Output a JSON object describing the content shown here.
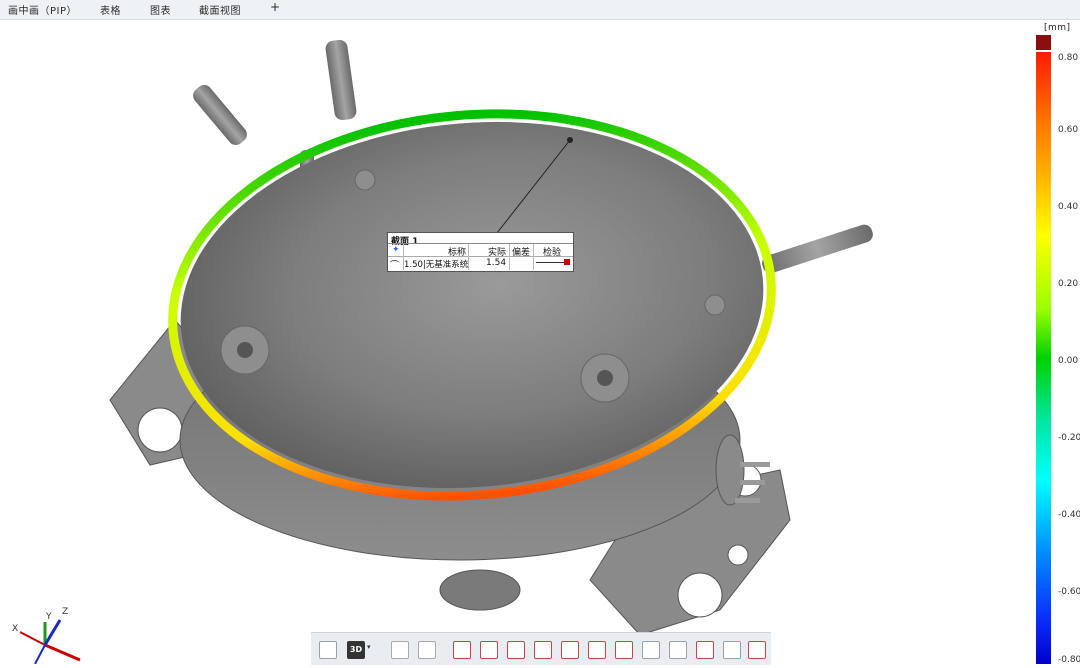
{
  "tabs": [
    {
      "label": "画中画（PIP）"
    },
    {
      "label": "表格"
    },
    {
      "label": "图表"
    },
    {
      "label": "截面视图"
    }
  ],
  "add_tab_label": "+",
  "color_scale": {
    "unit": "[mm]",
    "ticks": [
      "0.80",
      "0.60",
      "0.40",
      "0.20",
      "0.00",
      "-0.20",
      "-0.40",
      "-0.60",
      "-0.80"
    ],
    "over_color": "#8b0f0f"
  },
  "label_box": {
    "title": "截面 1",
    "headers": {
      "nominal": "标称",
      "actual": "实际",
      "deviation": "偏差",
      "check": "检验"
    },
    "row": {
      "nominal": "1.50|无基准系统",
      "actual": "1.54",
      "deviation": ""
    }
  },
  "axes": {
    "x": "X",
    "y": "Y",
    "z": "Z"
  },
  "toolbar": {
    "view_mode": "3D"
  }
}
